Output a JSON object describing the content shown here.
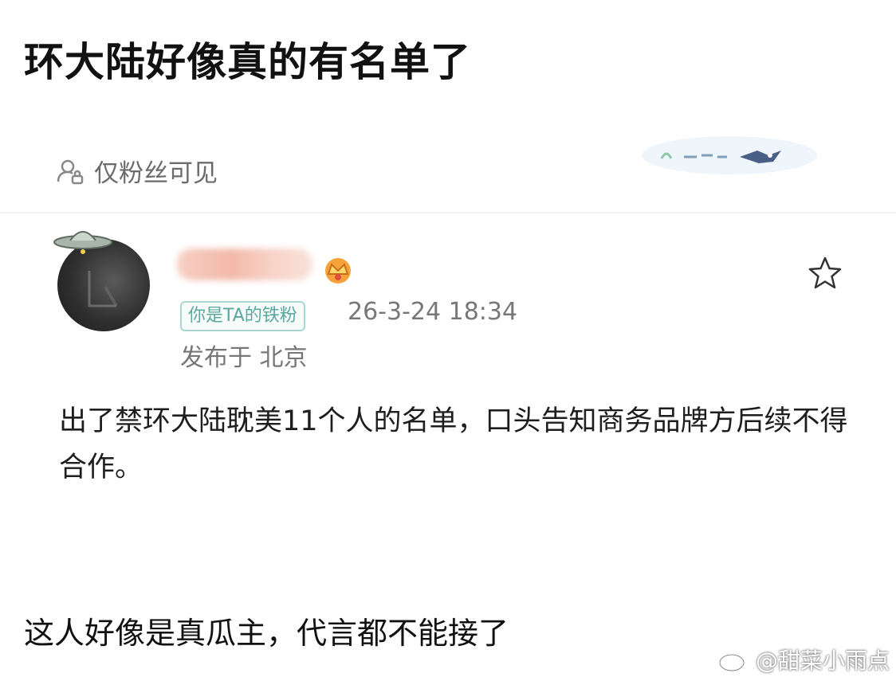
{
  "headline": "环大陆好像真的有名单了",
  "visibility": {
    "label": "仅粉丝可见",
    "icon": "lock-person-icon"
  },
  "post": {
    "badge": "你是TA的铁粉",
    "timestamp": "26-3-24 18:34",
    "location": "发布于 北京",
    "body": "出了禁环大陆耽美11个人的名单，口头告知商务品牌方后续不得合作。"
  },
  "caption": "这人好像是真瓜主，代言都不能接了",
  "watermark": "@甜菜小雨点",
  "colors": {
    "badge_border": "#a9d6d1",
    "badge_text": "#5aa79e",
    "meta_text": "#777777"
  }
}
